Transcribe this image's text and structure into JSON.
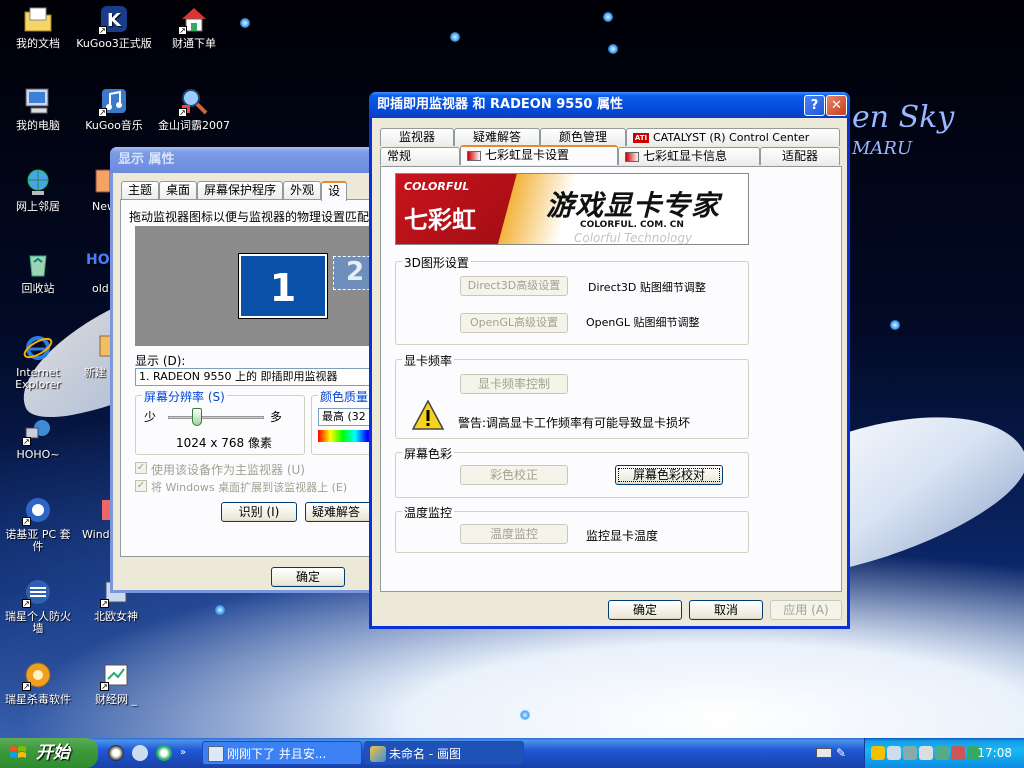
{
  "desktop": {
    "wallpaper_text_1": "en Sky",
    "wallpaper_text_2": "MARU",
    "icons": [
      {
        "label": "我的文档"
      },
      {
        "label": "KuGoo3正式版"
      },
      {
        "label": "财通下单"
      },
      {
        "label": "我的电脑"
      },
      {
        "label": "KuGoo音乐"
      },
      {
        "label": "金山词霸2007"
      },
      {
        "label": "网上邻居"
      },
      {
        "label": "New"
      },
      {
        "label": "回收站"
      },
      {
        "label": "old"
      },
      {
        "label": "Internet Explorer"
      },
      {
        "label": "新建"
      },
      {
        "label": "HOHO~"
      },
      {
        "label": "诺基亚 PC 套件"
      },
      {
        "label": "Wind"
      },
      {
        "label": "瑞星个人防火墙"
      },
      {
        "label": "北欧女神"
      },
      {
        "label": "瑞星杀毒软件"
      },
      {
        "label": "财经网 _"
      }
    ]
  },
  "display_props": {
    "title": "显示 属性",
    "tabs": [
      "主题",
      "桌面",
      "屏幕保护程序",
      "外观",
      "设"
    ],
    "instruction": "拖动监视器图标以便与监视器的物理设置匹配",
    "monitor_1": "1",
    "monitor_2": "2",
    "display_label": "显示 (D):",
    "display_value": "1. RADEON 9550  上的 即插即用监视器",
    "resolution_label": "屏幕分辨率 (S)",
    "res_less": "少",
    "res_more": "多",
    "resolution_value": "1024 x 768 像素",
    "color_label": "颜色质量",
    "color_value": "最高 (32",
    "primary_checkbox": "使用该设备作为主监视器 (U)",
    "extend_checkbox": "将 Windows 桌面扩展到该监视器上 (E)",
    "identify_button": "识别 (I)",
    "troubleshoot_button": "疑难解答",
    "ok_button": "确定"
  },
  "radeon_props": {
    "title": "即插即用监视器 和 RADEON 9550  属性",
    "help_btn": "?",
    "close_btn": "✕",
    "tabs_back": [
      "监视器",
      "疑难解答",
      "颜色管理",
      "CATALYST (R) Control Center"
    ],
    "tabs_front": [
      "常规",
      "七彩虹显卡设置",
      "七彩虹显卡信息",
      "适配器"
    ],
    "selected_tab": "七彩虹显卡设置",
    "banner": {
      "brand_en": "COLORFUL",
      "brand_cn": "七彩虹",
      "slogan": "游戏显卡专家",
      "url": "COLORFUL. COM. CN",
      "tagline": "Colorful Technology"
    },
    "group_3d": {
      "title": "3D图形设置",
      "d3d_button": "Direct3D高级设置",
      "d3d_desc": "Direct3D 贴图细节调整",
      "ogl_button": "OpenGL高级设置",
      "ogl_desc": "OpenGL 贴图细节调整"
    },
    "group_freq": {
      "title": "显卡频率",
      "button": "显卡频率控制",
      "warning": "警告:调高显卡工作频率有可能导致显卡损坏"
    },
    "group_color": {
      "title": "屏幕色彩",
      "calibrate_button": "彩色校正",
      "screen_color_button": "屏幕色彩校对"
    },
    "group_temp": {
      "title": "温度监控",
      "button": "温度监控",
      "desc": "监控显卡温度"
    },
    "ok_button": "确定",
    "cancel_button": "取消",
    "apply_button": "应用 (A)"
  },
  "taskbar": {
    "start_label": "开始",
    "tasks": [
      {
        "label": "刚刚下了 并且安..."
      },
      {
        "label": "未命名 - 画图"
      }
    ],
    "clock": "17:08"
  }
}
